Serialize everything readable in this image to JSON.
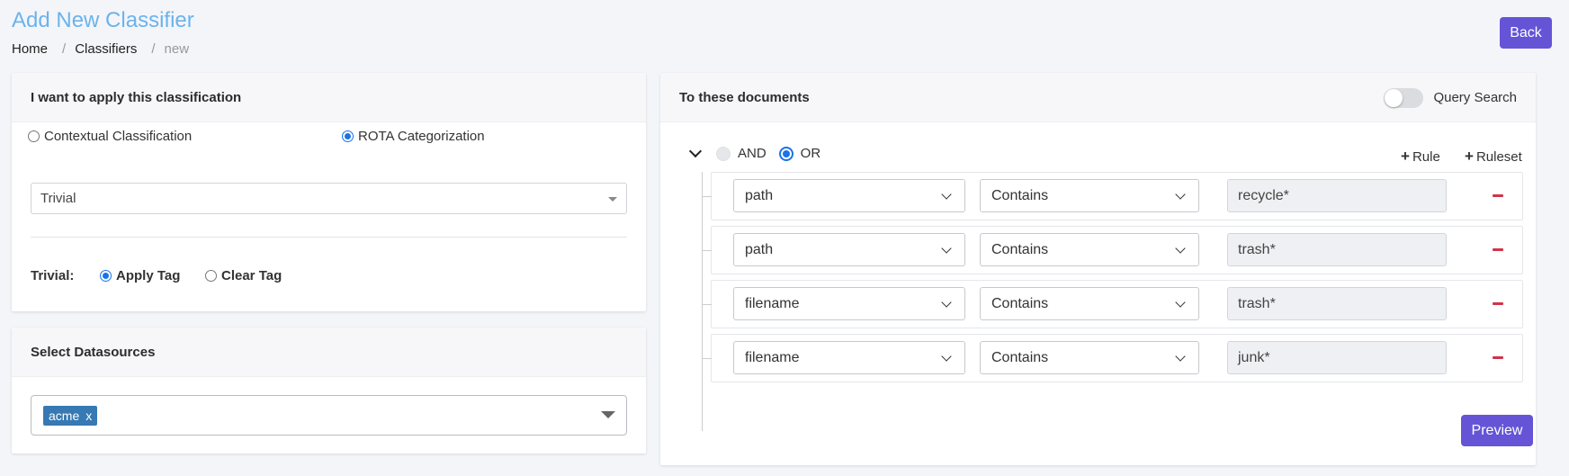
{
  "page": {
    "title": "Add New Classifier",
    "breadcrumb": [
      "Home",
      "Classifiers",
      "new"
    ],
    "back_label": "Back"
  },
  "classification_card": {
    "header": "I want to apply this classification",
    "options": [
      {
        "label": "Contextual Classification",
        "checked": false
      },
      {
        "label": "ROTA Categorization",
        "checked": true
      }
    ],
    "selected_category": "Trivial",
    "tag_row": {
      "label": "Trivial:",
      "options": [
        {
          "label": "Apply Tag",
          "checked": true
        },
        {
          "label": "Clear Tag",
          "checked": false
        }
      ]
    }
  },
  "datasources_card": {
    "header": "Select Datasources",
    "selected_tags": [
      {
        "label": "acme",
        "remove": "x"
      }
    ]
  },
  "query_card": {
    "header": "To these documents",
    "query_search_label": "Query Search",
    "query_search_on": false,
    "conditions": [
      {
        "label": "AND",
        "checked": false
      },
      {
        "label": "OR",
        "checked": true
      }
    ],
    "add_rule_label": "Rule",
    "add_ruleset_label": "Ruleset",
    "rules": [
      {
        "field": "path",
        "operator": "Contains",
        "value": "recycle*"
      },
      {
        "field": "path",
        "operator": "Contains",
        "value": "trash*"
      },
      {
        "field": "filename",
        "operator": "Contains",
        "value": "trash*"
      },
      {
        "field": "filename",
        "operator": "Contains",
        "value": "junk*"
      }
    ],
    "preview_label": "Preview"
  },
  "colors": {
    "accent": "#6554d6",
    "title": "#6bb3ec",
    "tag": "#3779b3",
    "remove": "#d1344a",
    "radio": "#1a73e8"
  }
}
